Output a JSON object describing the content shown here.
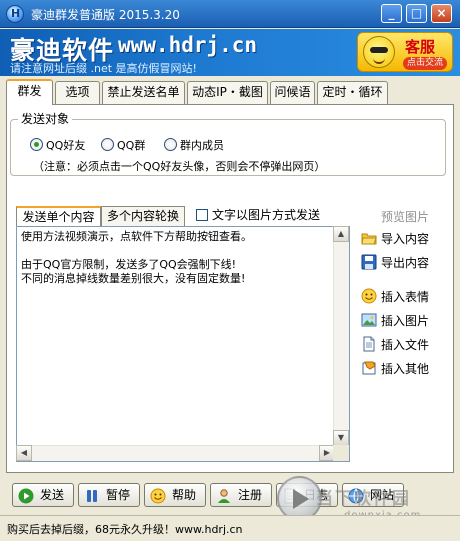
{
  "window": {
    "title": "豪迪群发普通版 2015.3.20",
    "minimize": "_",
    "maximize": "□",
    "close": "×"
  },
  "banner": {
    "brand": "豪迪软件",
    "url": "www.hdrj.cn",
    "notice": "请注意网址后缀 .net 是高仿假冒网站!",
    "service_label": "客服",
    "service_sub": "点击交流"
  },
  "tabs": [
    "群发",
    "选项",
    "禁止发送名单",
    "动态IP・截图",
    "问候语",
    "定时・循环"
  ],
  "send_target": {
    "title": "发送对象",
    "options": [
      {
        "label": "QQ好友",
        "checked": true
      },
      {
        "label": "QQ群",
        "checked": false
      },
      {
        "label": "群内成员",
        "checked": false
      }
    ],
    "note": "（注意：必须点击一个QQ好友头像，否则会不停弹出网页）"
  },
  "content_tabs": [
    "发送单个内容",
    "多个内容轮换"
  ],
  "image_checkbox": {
    "label": "文字以图片方式发送",
    "checked": false
  },
  "preview_image": "预览图片",
  "message": "使用方法视频演示，点软件下方帮助按钮查看。\n\n由于QQ官方限制，发送多了QQ会强制下线!\n不同的消息掉线数量差别很大，没有固定数量!",
  "side_actions": [
    {
      "label": "导入内容",
      "icon": "folder-open-icon"
    },
    {
      "label": "导出内容",
      "icon": "floppy-disk-icon"
    },
    {
      "label": "插入表情",
      "icon": "smiley-icon"
    },
    {
      "label": "插入图片",
      "icon": "picture-icon"
    },
    {
      "label": "插入文件",
      "icon": "document-icon"
    },
    {
      "label": "插入其他",
      "icon": "insert-other-icon"
    }
  ],
  "buttons": [
    {
      "label": "发送",
      "icon": "play-icon"
    },
    {
      "label": "暂停",
      "icon": "pause-icon"
    },
    {
      "label": "帮助",
      "icon": "help-smiley-icon"
    },
    {
      "label": "注册",
      "icon": "user-icon"
    },
    {
      "label": "日志",
      "icon": "log-icon"
    },
    {
      "label": "网站",
      "icon": "web-icon"
    }
  ],
  "status": "购买后去掉后缀，68元永久升级！www.hdrj.cn",
  "watermark": {
    "text": "当下软件园",
    "sub": "downxia.com"
  }
}
